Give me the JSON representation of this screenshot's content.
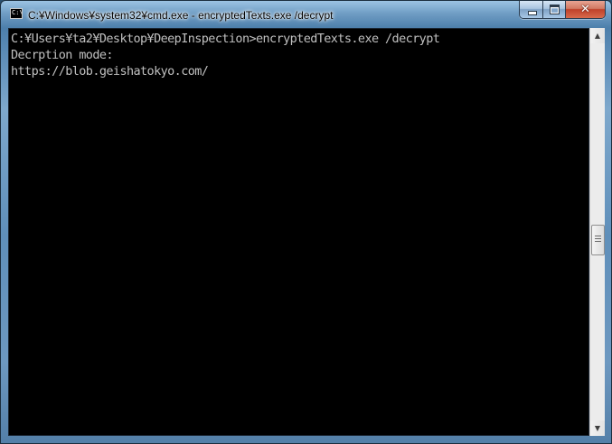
{
  "window": {
    "title": "C:¥Windows¥system32¥cmd.exe - encryptedTexts.exe  /decrypt",
    "icon_label": "C:\\",
    "icons": {
      "app": "console-icon",
      "minimize": "minimize-icon",
      "maximize": "maximize-icon",
      "close": "close-icon",
      "close_glyph": "✕"
    }
  },
  "console": {
    "lines": [
      "C:¥Users¥ta2¥Desktop¥DeepInspection>encryptedTexts.exe /decrypt",
      "Decrption mode:",
      "https://blob.geishatokyo.com/"
    ],
    "colors": {
      "background": "#000000",
      "foreground": "#c0c0c0"
    }
  },
  "scrollbar": {
    "up_arrow": "▲",
    "down_arrow": "▼"
  }
}
